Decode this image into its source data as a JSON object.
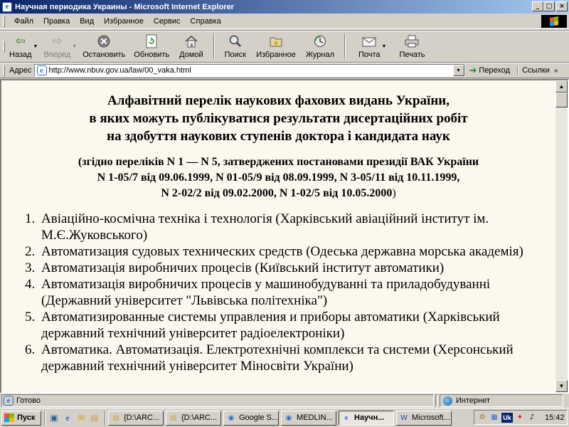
{
  "window": {
    "title": "Научная периодика Украины - Microsoft Internet Explorer",
    "controls": {
      "minimize": "_",
      "maximize": "□",
      "close": "×"
    }
  },
  "menu": {
    "items": [
      "Файл",
      "Правка",
      "Вид",
      "Избранное",
      "Сервис",
      "Справка"
    ]
  },
  "toolbar": {
    "back": "Назад",
    "forward": "Вперед",
    "stop": "Остановить",
    "refresh": "Обновить",
    "home": "Домой",
    "search": "Поиск",
    "favorites": "Избранное",
    "history": "Журнал",
    "mail": "Почта",
    "print": "Печать"
  },
  "address": {
    "label": "Адрес",
    "url": "http://www.nbuv.gov.ua/law/00_vaka.html",
    "go": "Переход",
    "links": "Ссылки"
  },
  "content": {
    "heading_lines": [
      "Алфавітний перелік наукових фахових видань України,",
      "в яких можуть публікуватися результати дисертаційних робіт",
      "на здобуття наукових ступенів доктора і кандидата наук"
    ],
    "sub_lines": [
      "(згідно переліків N 1 — N 5, затверджених постановами президії ВАК України",
      "N 1-05/7 від 09.06.1999, N 01-05/9 від 08.09.1999, N 3-05/11 від 10.11.1999,",
      "N 2-02/2 від 09.02.2000, N 1-02/5 від 10.05.2000"
    ],
    "sub_close": ")",
    "items": [
      "Авіаційно-космічна техніка і технологія (Харківський авіаційний інститут ім. М.Є.Жуковського)",
      "Автоматизация судовых технических средств (Одеська державна морська академія)",
      "Автоматизація виробничих процесів (Київський інститут автоматики)",
      "Автоматизація виробничих процесів у машинобудуванні та приладобудуванні (Державний університет \"Львівська політехніка\")",
      "Автоматизированные системы управления и приборы автоматики (Харківський державний технічний університет радіоелектроніки)",
      "Автоматика. Автоматизація. Електротехнічні комплекси та системи (Херсонський державний технічний університет Міносвіти України)"
    ]
  },
  "status": {
    "text": "Готово",
    "zone": "Интернет"
  },
  "taskbar": {
    "start": "Пуск",
    "tasks": [
      "{D:\\ARC...",
      "{D:\\ARC...",
      "Google S...",
      "MEDLIN...",
      "Научн...",
      "Microsoft..."
    ],
    "active_index": 4,
    "lang": "Uk",
    "clock": "15:42"
  }
}
